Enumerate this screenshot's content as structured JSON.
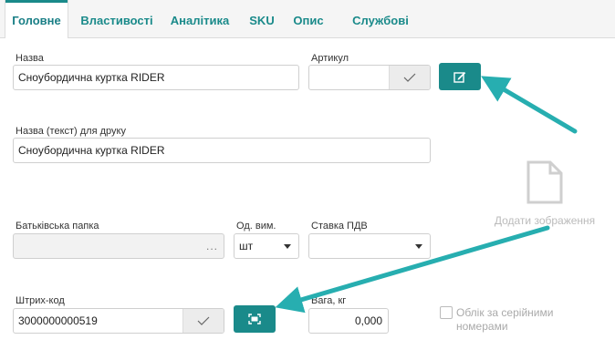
{
  "tabs": [
    {
      "label": "Головне",
      "active": true
    },
    {
      "label": "Властивості"
    },
    {
      "label": "Аналітика"
    },
    {
      "label": "SKU"
    },
    {
      "label": "Опис"
    },
    {
      "label": "Службові"
    }
  ],
  "form": {
    "name_label": "Назва",
    "name_value": "Сноубордична куртка RIDER",
    "article_label": "Артикул",
    "article_value": "",
    "print_name_label": "Назва (текст) для друку",
    "print_name_value": "Сноубордична куртка RIDER",
    "parent_folder_label": "Батьківська папка",
    "parent_folder_value": "",
    "parent_folder_dots": "...",
    "unit_label": "Од. вим.",
    "unit_value": "шт",
    "vat_label": "Ставка ПДВ",
    "vat_value": "",
    "barcode_label": "Штрих-код",
    "barcode_value": "3000000000519",
    "weight_label": "Вага, кг",
    "weight_value": "0,000",
    "serial_label": "Облік за серійними номерами"
  },
  "image_placeholder": {
    "text": "Додати зображення",
    "icon": "document-icon"
  },
  "colors": {
    "accent": "#1a8a8a",
    "arrow": "#27aeb0"
  }
}
